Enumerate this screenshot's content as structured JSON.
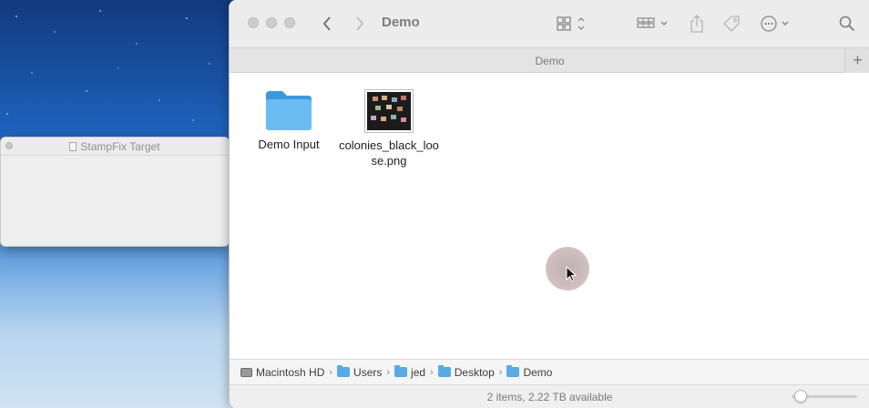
{
  "small_window": {
    "title": "StampFix Target"
  },
  "finder": {
    "title": "Demo",
    "tab_label": "Demo",
    "tab_add": "+",
    "items": [
      {
        "name": "Demo Input",
        "kind": "folder",
        "icon": "folder-icon"
      },
      {
        "name": "colonies_black_loose.png",
        "kind": "image",
        "icon": "image-thumbnail"
      }
    ],
    "path": [
      "Macintosh HD",
      "Users",
      "jed",
      "Desktop",
      "Demo"
    ],
    "status": "2 items, 2.22 TB available",
    "icon_size_fraction": 0.05,
    "accent_folder_color": "#5aaae6"
  }
}
